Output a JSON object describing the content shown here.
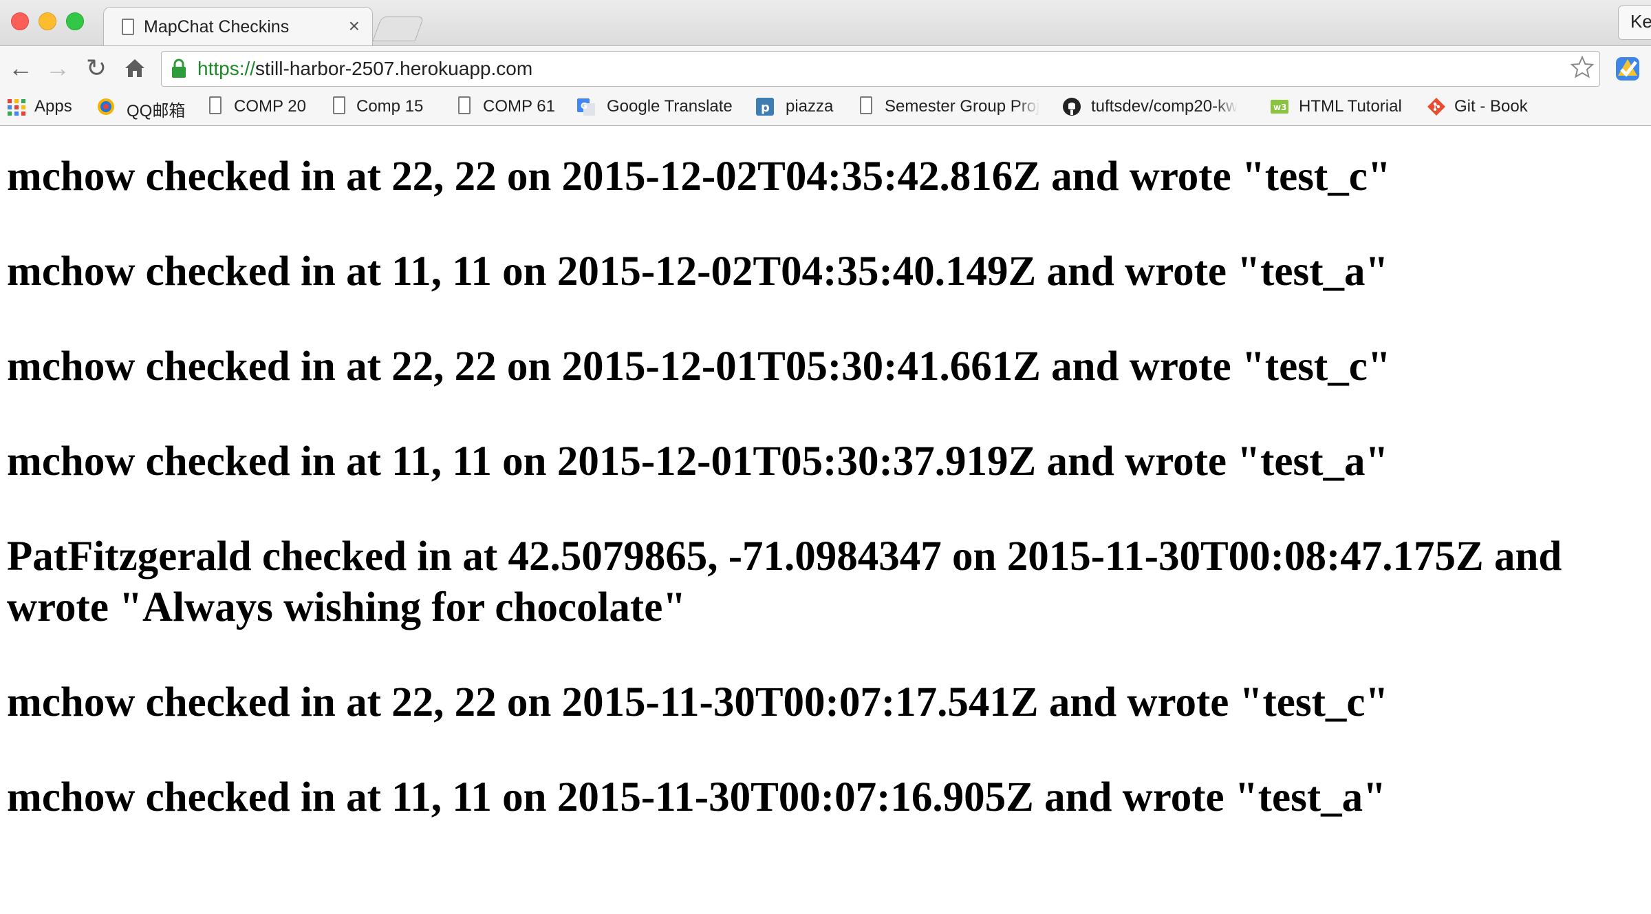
{
  "browser": {
    "tab": {
      "title": "MapChat Checkins",
      "close_label": "×"
    },
    "profile_label": "Ke",
    "address": {
      "scheme": "https://",
      "host": "still-harbor-2507.herokuapp.com"
    },
    "bookmarks": [
      {
        "label": "Apps",
        "icon": "apps-grid-icon"
      },
      {
        "label": "QQ邮箱",
        "icon": "qq-mail-icon"
      },
      {
        "label": "COMP 20",
        "icon": "page-icon"
      },
      {
        "label": "Comp 15",
        "icon": "page-icon"
      },
      {
        "label": "COMP 61",
        "icon": "page-icon"
      },
      {
        "label": "Google Translate",
        "icon": "google-translate-icon"
      },
      {
        "label": "piazza",
        "icon": "piazza-icon"
      },
      {
        "label": "Semester Group Proj",
        "icon": "page-icon"
      },
      {
        "label": "tuftsdev/comp20-kw",
        "icon": "github-icon"
      },
      {
        "label": "HTML Tutorial",
        "icon": "w3schools-icon"
      },
      {
        "label": "Git - Book",
        "icon": "git-icon"
      }
    ]
  },
  "checkins": [
    "mchow checked in at 22, 22 on 2015-12-02T04:35:42.816Z and wrote \"test_c\"",
    "mchow checked in at 11, 11 on 2015-12-02T04:35:40.149Z and wrote \"test_a\"",
    "mchow checked in at 22, 22 on 2015-12-01T05:30:41.661Z and wrote \"test_c\"",
    "mchow checked in at 11, 11 on 2015-12-01T05:30:37.919Z and wrote \"test_a\"",
    "PatFitzgerald checked in at 42.5079865, -71.0984347 on 2015-11-30T00:08:47.175Z and wrote \"Always wishing for chocolate\"",
    "mchow checked in at 22, 22 on 2015-11-30T00:07:17.541Z and wrote \"test_c\"",
    "mchow checked in at 11, 11 on 2015-11-30T00:07:16.905Z and wrote \"test_a\""
  ]
}
